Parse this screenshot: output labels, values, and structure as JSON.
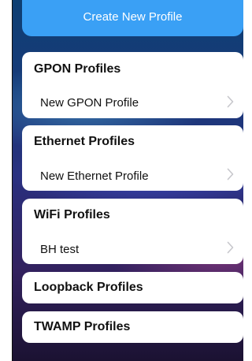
{
  "create_button": {
    "label": "Create New Profile"
  },
  "sections": [
    {
      "title": "GPON Profiles",
      "items": [
        {
          "label": "New GPON Profile"
        }
      ]
    },
    {
      "title": "Ethernet Profiles",
      "items": [
        {
          "label": "New Ethernet Profile"
        }
      ]
    },
    {
      "title": "WiFi Profiles",
      "items": [
        {
          "label": "BH test"
        }
      ]
    },
    {
      "title": "Loopback Profiles",
      "items": []
    },
    {
      "title": "TWAMP Profiles",
      "items": []
    }
  ],
  "colors": {
    "accent": "#3aa0f5",
    "card": "#ffffff",
    "chevron": "#c7c7cc"
  },
  "icons": {
    "row_disclosure": "chevron-right-icon"
  }
}
